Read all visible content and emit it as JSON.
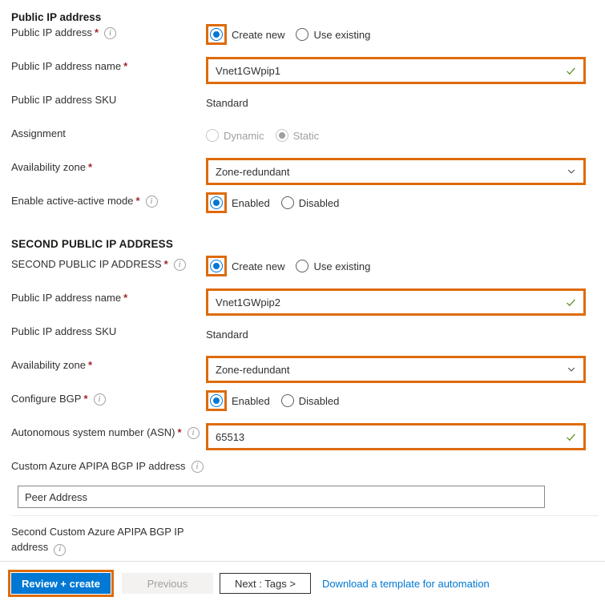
{
  "colors": {
    "accent": "#0078d4",
    "highlight": "#de6b0b",
    "required": "#a4262c",
    "valid": "#498205",
    "disabled_text": "#a19f9d"
  },
  "sections": {
    "public_ip": {
      "heading": "Public IP address"
    },
    "second_public_ip": {
      "heading": "SECOND PUBLIC IP ADDRESS"
    }
  },
  "rows": {
    "public_ip_address": {
      "label": "Public IP address",
      "required": "*",
      "option_create_new": "Create new",
      "option_use_existing": "Use existing",
      "selected": "Create new"
    },
    "public_ip_name_1": {
      "label": "Public IP address name",
      "required": "*",
      "value": "Vnet1GWpip1"
    },
    "public_ip_sku_1": {
      "label": "Public IP address SKU",
      "value": "Standard"
    },
    "assignment": {
      "label": "Assignment",
      "option_dynamic": "Dynamic",
      "option_static": "Static",
      "selected": "Static"
    },
    "availability_zone_1": {
      "label": "Availability zone",
      "required": "*",
      "value": "Zone-redundant"
    },
    "active_active": {
      "label": "Enable active-active mode",
      "required": "*",
      "option_enabled": "Enabled",
      "option_disabled": "Disabled",
      "selected": "Enabled"
    },
    "second_public_ip_address": {
      "label": "SECOND PUBLIC IP ADDRESS",
      "required": "*",
      "option_create_new": "Create new",
      "option_use_existing": "Use existing",
      "selected": "Create new"
    },
    "public_ip_name_2": {
      "label": "Public IP address name",
      "required": "*",
      "value": "Vnet1GWpip2"
    },
    "public_ip_sku_2": {
      "label": "Public IP address SKU",
      "value": "Standard"
    },
    "availability_zone_2": {
      "label": "Availability zone",
      "required": "*",
      "value": "Zone-redundant"
    },
    "configure_bgp": {
      "label": "Configure BGP",
      "required": "*",
      "option_enabled": "Enabled",
      "option_disabled": "Disabled",
      "selected": "Enabled"
    },
    "asn": {
      "label": "Autonomous system number (ASN)",
      "required": "*",
      "value": "65513"
    },
    "apipa_bgp_ip": {
      "label": "Custom Azure APIPA BGP IP address",
      "peer_placeholder": "Peer Address",
      "peer_value": ""
    },
    "second_apipa_bgp_ip": {
      "label_line1": "Second Custom Azure APIPA BGP IP",
      "label_line2": "address"
    }
  },
  "footer": {
    "review_create": "Review + create",
    "previous": "Previous",
    "next": "Next : Tags >",
    "download_template": "Download a template for automation"
  }
}
